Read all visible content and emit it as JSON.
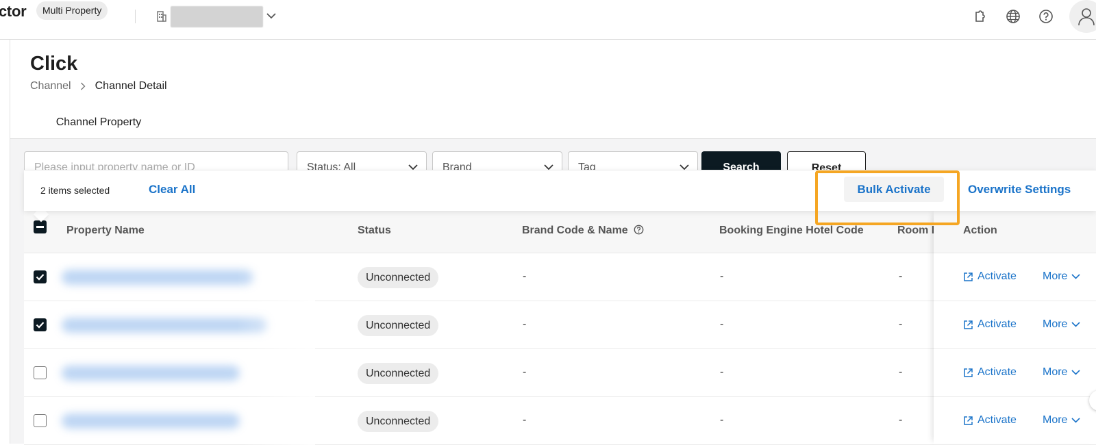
{
  "topbar": {
    "brand": "ctor",
    "badge": "Multi Property",
    "icons": [
      "puzzle-icon",
      "globe-icon",
      "help-icon",
      "user-icon"
    ]
  },
  "header": {
    "title": "Click",
    "breadcrumb": {
      "parent": "Channel",
      "current": "Channel Detail"
    },
    "tab": "Channel Property"
  },
  "filters": {
    "search_placeholder": "Please input property name or ID",
    "status": "Status: All",
    "brand": "Brand",
    "tag": "Tag",
    "search_label": "Search",
    "reset_label": "Reset"
  },
  "selection_bar": {
    "count_text": "2 items selected",
    "clear_all": "Clear All",
    "bulk_activate": "Bulk Activate",
    "overwrite_settings": "Overwrite Settings",
    "highlight_color": "#f5a623"
  },
  "table": {
    "columns": {
      "property_name": "Property Name",
      "status": "Status",
      "brand": "Brand Code & Name",
      "booking_engine": "Booking Engine Hotel Code",
      "room_rate": "Room Rat",
      "action": "Action"
    },
    "rows": [
      {
        "checked": true,
        "status": "Unconnected",
        "brand": "-",
        "booking": "-",
        "room": "-",
        "activate": "Activate",
        "more": "More"
      },
      {
        "checked": true,
        "status": "Unconnected",
        "brand": "-",
        "booking": "-",
        "room": "-",
        "activate": "Activate",
        "more": "More"
      },
      {
        "checked": false,
        "status": "Unconnected",
        "brand": "-",
        "booking": "-",
        "room": "-",
        "activate": "Activate",
        "more": "More"
      },
      {
        "checked": false,
        "status": "Unconnected",
        "brand": "-",
        "booking": "-",
        "room": "-",
        "activate": "Activate",
        "more": "More"
      }
    ]
  },
  "colors": {
    "link": "#1a73c9",
    "primary_dark": "#0c1a22",
    "surface": "#f4f4f5"
  }
}
